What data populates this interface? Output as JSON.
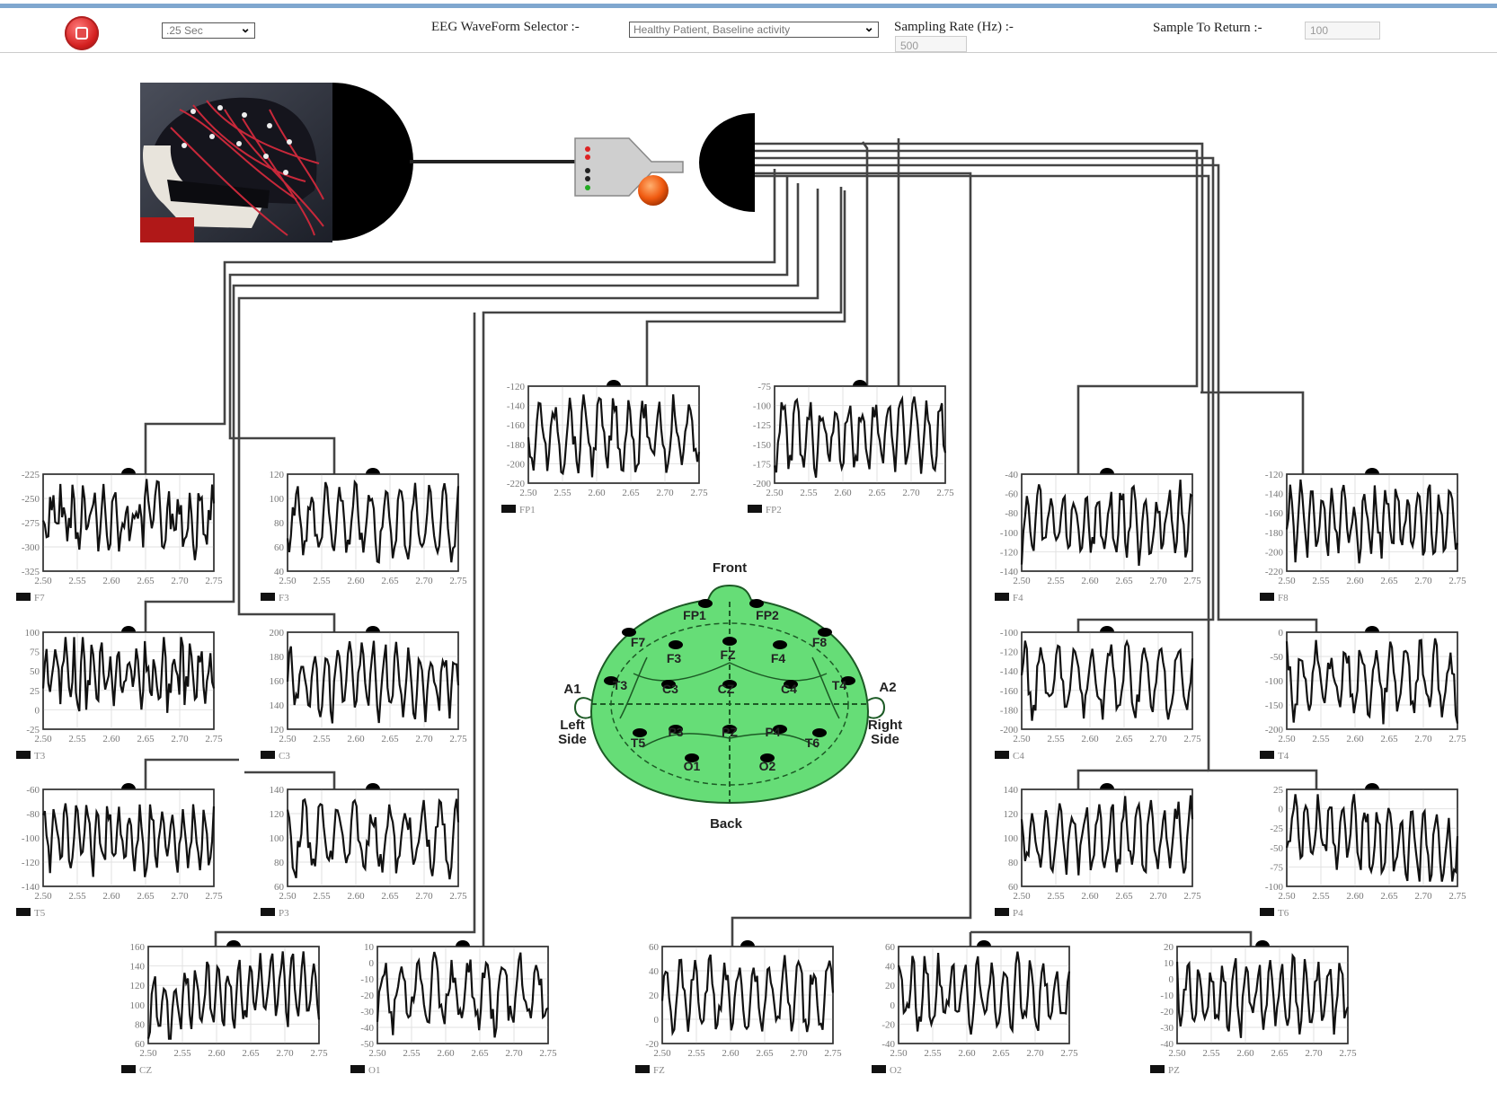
{
  "toolbar": {
    "duration_value": ".25 Sec",
    "waveform_label": "EEG WaveForm Selector :-",
    "waveform_value": "Healthy Patient, Baseline activity",
    "sampling_label": "Sampling Rate  (Hz)  :-",
    "sampling_value": "500",
    "samples_label": "Sample To Return  :-",
    "samples_value": "100"
  },
  "head_map": {
    "front": "Front",
    "back": "Back",
    "left": "Left Side",
    "right": "Right Side",
    "ears": [
      "A1",
      "A2"
    ],
    "electrodes": [
      "FP1",
      "FP2",
      "F7",
      "F3",
      "FZ",
      "F4",
      "F8",
      "T3",
      "C3",
      "CZ",
      "C4",
      "T4",
      "T5",
      "P3",
      "PZ",
      "P4",
      "T6",
      "O1",
      "O2"
    ],
    "fill_color": "#66dd77"
  },
  "colors": {
    "wire": "#444444",
    "trace": "#111111",
    "grid": "#e2e2e2",
    "accent_topline": "#7fa7cf"
  },
  "chart_data": [
    {
      "type": "line",
      "name": "F7",
      "x_ticks": [
        "2.50",
        "2.55",
        "2.60",
        "2.65",
        "2.70",
        "2.75"
      ],
      "y_ticks": [
        "-225",
        "-250",
        "-275",
        "-300",
        "-325"
      ],
      "ylim": [
        -325,
        -225
      ],
      "xlim": [
        2.5,
        2.75
      ]
    },
    {
      "type": "line",
      "name": "F3",
      "x_ticks": [
        "2.50",
        "2.55",
        "2.60",
        "2.65",
        "2.70",
        "2.75"
      ],
      "y_ticks": [
        "120",
        "100",
        "80",
        "60",
        "40"
      ],
      "ylim": [
        40,
        120
      ],
      "xlim": [
        2.5,
        2.75
      ]
    },
    {
      "type": "line",
      "name": "T3",
      "x_ticks": [
        "2.50",
        "2.55",
        "2.60",
        "2.65",
        "2.70",
        "2.75"
      ],
      "y_ticks": [
        "100",
        "75",
        "50",
        "25",
        "0",
        "-25"
      ],
      "ylim": [
        -25,
        100
      ],
      "xlim": [
        2.5,
        2.75
      ]
    },
    {
      "type": "line",
      "name": "C3",
      "x_ticks": [
        "2.50",
        "2.55",
        "2.60",
        "2.65",
        "2.70",
        "2.75"
      ],
      "y_ticks": [
        "200",
        "180",
        "160",
        "140",
        "120"
      ],
      "ylim": [
        120,
        200
      ],
      "xlim": [
        2.5,
        2.75
      ]
    },
    {
      "type": "line",
      "name": "T5",
      "x_ticks": [
        "2.50",
        "2.55",
        "2.60",
        "2.65",
        "2.70",
        "2.75"
      ],
      "y_ticks": [
        "-60",
        "-80",
        "-100",
        "-120",
        "-140"
      ],
      "ylim": [
        -140,
        -60
      ],
      "xlim": [
        2.5,
        2.75
      ]
    },
    {
      "type": "line",
      "name": "P3",
      "x_ticks": [
        "2.50",
        "2.55",
        "2.60",
        "2.65",
        "2.70",
        "2.75"
      ],
      "y_ticks": [
        "140",
        "120",
        "100",
        "80",
        "60"
      ],
      "ylim": [
        60,
        140
      ],
      "xlim": [
        2.5,
        2.75
      ]
    },
    {
      "type": "line",
      "name": "FP1",
      "x_ticks": [
        "2.50",
        "2.55",
        "2.60",
        "2.65",
        "2.70",
        "2.75"
      ],
      "y_ticks": [
        "-120",
        "-140",
        "-160",
        "-180",
        "-200",
        "-220"
      ],
      "ylim": [
        -220,
        -120
      ],
      "xlim": [
        2.5,
        2.75
      ]
    },
    {
      "type": "line",
      "name": "FP2",
      "x_ticks": [
        "2.50",
        "2.55",
        "2.60",
        "2.65",
        "2.70",
        "2.75"
      ],
      "y_ticks": [
        "-75",
        "-100",
        "-125",
        "-150",
        "-175",
        "-200"
      ],
      "ylim": [
        -200,
        -75
      ],
      "xlim": [
        2.5,
        2.75
      ]
    },
    {
      "type": "line",
      "name": "F4",
      "x_ticks": [
        "2.50",
        "2.55",
        "2.60",
        "2.65",
        "2.70",
        "2.75"
      ],
      "y_ticks": [
        "-40",
        "-60",
        "-80",
        "-100",
        "-120",
        "-140"
      ],
      "ylim": [
        -140,
        -40
      ],
      "xlim": [
        2.5,
        2.75
      ]
    },
    {
      "type": "line",
      "name": "F8",
      "x_ticks": [
        "2.50",
        "2.55",
        "2.60",
        "2.65",
        "2.70",
        "2.75"
      ],
      "y_ticks": [
        "-120",
        "-140",
        "-160",
        "-180",
        "-200",
        "-220"
      ],
      "ylim": [
        -220,
        -120
      ],
      "xlim": [
        2.5,
        2.75
      ]
    },
    {
      "type": "line",
      "name": "C4",
      "x_ticks": [
        "2.50",
        "2.55",
        "2.60",
        "2.65",
        "2.70",
        "2.75"
      ],
      "y_ticks": [
        "-100",
        "-120",
        "-140",
        "-160",
        "-180",
        "-200"
      ],
      "ylim": [
        -200,
        -100
      ],
      "xlim": [
        2.5,
        2.75
      ]
    },
    {
      "type": "line",
      "name": "T4",
      "x_ticks": [
        "2.50",
        "2.55",
        "2.60",
        "2.65",
        "2.70",
        "2.75"
      ],
      "y_ticks": [
        "0",
        "-50",
        "-100",
        "-150",
        "-200"
      ],
      "ylim": [
        -200,
        0
      ],
      "xlim": [
        2.5,
        2.75
      ]
    },
    {
      "type": "line",
      "name": "P4",
      "x_ticks": [
        "2.50",
        "2.55",
        "2.60",
        "2.65",
        "2.70",
        "2.75"
      ],
      "y_ticks": [
        "140",
        "120",
        "100",
        "80",
        "60"
      ],
      "ylim": [
        60,
        140
      ],
      "xlim": [
        2.5,
        2.75
      ]
    },
    {
      "type": "line",
      "name": "T6",
      "x_ticks": [
        "2.50",
        "2.55",
        "2.60",
        "2.65",
        "2.70",
        "2.75"
      ],
      "y_ticks": [
        "25",
        "0",
        "-25",
        "-50",
        "-75",
        "-100"
      ],
      "ylim": [
        -100,
        25
      ],
      "xlim": [
        2.5,
        2.75
      ]
    },
    {
      "type": "line",
      "name": "CZ",
      "x_ticks": [
        "2.50",
        "2.55",
        "2.60",
        "2.65",
        "2.70",
        "2.75"
      ],
      "y_ticks": [
        "160",
        "140",
        "120",
        "100",
        "80",
        "60"
      ],
      "ylim": [
        60,
        160
      ],
      "xlim": [
        2.5,
        2.75
      ]
    },
    {
      "type": "line",
      "name": "O1",
      "x_ticks": [
        "2.50",
        "2.55",
        "2.60",
        "2.65",
        "2.70",
        "2.75"
      ],
      "y_ticks": [
        "10",
        "0",
        "-10",
        "-20",
        "-30",
        "-40",
        "-50"
      ],
      "ylim": [
        -50,
        10
      ],
      "xlim": [
        2.5,
        2.75
      ]
    },
    {
      "type": "line",
      "name": "FZ",
      "x_ticks": [
        "2.50",
        "2.55",
        "2.60",
        "2.65",
        "2.70",
        "2.75"
      ],
      "y_ticks": [
        "60",
        "40",
        "20",
        "0",
        "-20"
      ],
      "ylim": [
        -20,
        60
      ],
      "xlim": [
        2.5,
        2.75
      ]
    },
    {
      "type": "line",
      "name": "O2",
      "x_ticks": [
        "2.50",
        "2.55",
        "2.60",
        "2.65",
        "2.70",
        "2.75"
      ],
      "y_ticks": [
        "60",
        "40",
        "20",
        "0",
        "-20",
        "-40"
      ],
      "ylim": [
        -40,
        60
      ],
      "xlim": [
        2.5,
        2.75
      ]
    },
    {
      "type": "line",
      "name": "PZ",
      "x_ticks": [
        "2.50",
        "2.55",
        "2.60",
        "2.65",
        "2.70",
        "2.75"
      ],
      "y_ticks": [
        "20",
        "10",
        "0",
        "-10",
        "-20",
        "-30",
        "-40"
      ],
      "ylim": [
        -40,
        20
      ],
      "xlim": [
        2.5,
        2.75
      ]
    }
  ]
}
